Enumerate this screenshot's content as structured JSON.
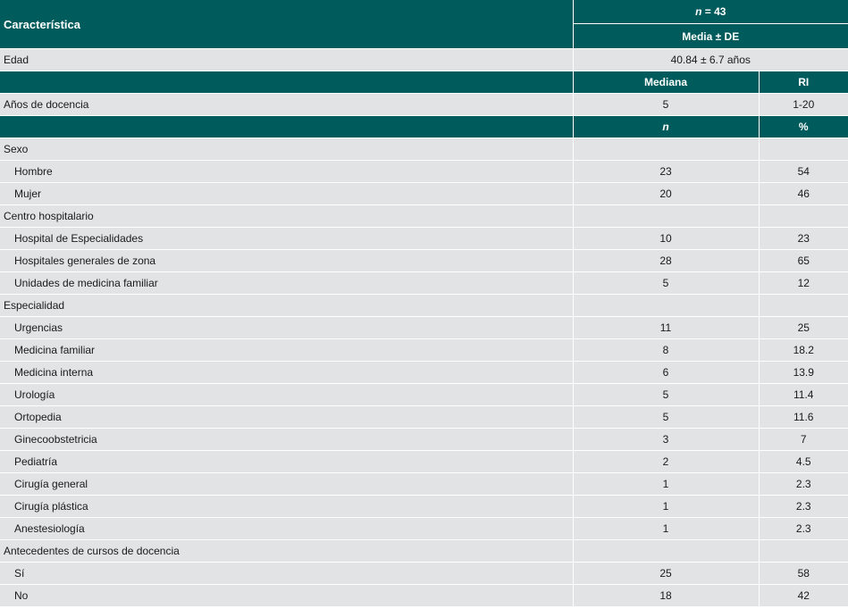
{
  "header": {
    "characteristic": "Característica",
    "n_symbol": "n",
    "n_rest": " = 43",
    "mean_sd": "Media ± DE"
  },
  "age": {
    "label": "Edad",
    "value": "40.84 ± 6.7 años"
  },
  "median_header": {
    "median": "Mediana",
    "ri": "RI"
  },
  "teaching": {
    "label": "Años de docencia",
    "median": "5",
    "ri": "1-20"
  },
  "count_header": {
    "n": "n",
    "pct": "%"
  },
  "groups": [
    {
      "title": "Sexo",
      "rows": [
        {
          "label": "Hombre",
          "n": "23",
          "pct": "54"
        },
        {
          "label": "Mujer",
          "n": "20",
          "pct": "46"
        }
      ]
    },
    {
      "title": "Centro hospitalario",
      "rows": [
        {
          "label": "Hospital de Especialidades",
          "n": "10",
          "pct": "23"
        },
        {
          "label": "Hospitales generales de zona",
          "n": "28",
          "pct": "65"
        },
        {
          "label": "Unidades de medicina familiar",
          "n": "5",
          "pct": "12"
        }
      ]
    },
    {
      "title": "Especialidad",
      "rows": [
        {
          "label": "Urgencias",
          "n": "11",
          "pct": "25"
        },
        {
          "label": "Medicina familiar",
          "n": "8",
          "pct": "18.2"
        },
        {
          "label": "Medicina interna",
          "n": "6",
          "pct": "13.9"
        },
        {
          "label": "Urología",
          "n": "5",
          "pct": "11.4"
        },
        {
          "label": "Ortopedia",
          "n": "5",
          "pct": "11.6"
        },
        {
          "label": "Ginecoobstetricia",
          "n": "3",
          "pct": "7"
        },
        {
          "label": "Pediatría",
          "n": "2",
          "pct": "4.5"
        },
        {
          "label": "Cirugía general",
          "n": "1",
          "pct": "2.3"
        },
        {
          "label": "Cirugía plástica",
          "n": "1",
          "pct": "2.3"
        },
        {
          "label": "Anestesiología",
          "n": "1",
          "pct": "2.3"
        }
      ]
    },
    {
      "title": "Antecedentes de cursos de docencia",
      "rows": [
        {
          "label": "Sí",
          "n": "25",
          "pct": "58"
        },
        {
          "label": "No",
          "n": "18",
          "pct": "42"
        }
      ]
    }
  ]
}
